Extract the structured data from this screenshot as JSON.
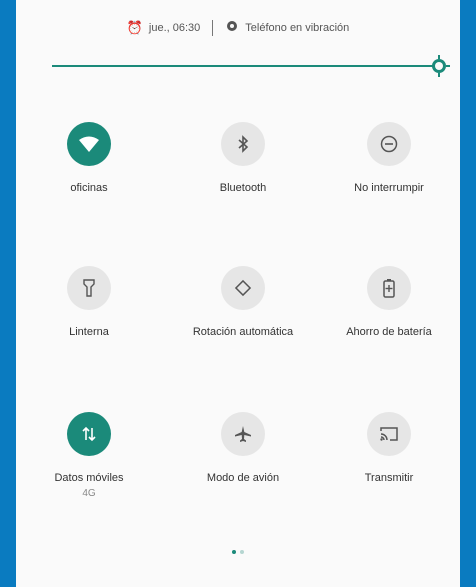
{
  "status": {
    "alarm_text": "jue., 06:30",
    "ringer_text": "Teléfono en vibración"
  },
  "brightness": {
    "level": 1.0
  },
  "tiles": [
    {
      "label": "oficinas",
      "icon": "wifi-icon",
      "active": true
    },
    {
      "label": "Bluetooth",
      "icon": "bluetooth-icon",
      "active": false
    },
    {
      "label": "No interrumpir",
      "icon": "do-not-disturb-icon",
      "active": false
    },
    {
      "label": "Linterna",
      "icon": "flashlight-icon",
      "active": false
    },
    {
      "label": "Rotación automática",
      "icon": "auto-rotate-icon",
      "active": false
    },
    {
      "label": "Ahorro de batería",
      "icon": "battery-saver-icon",
      "active": false
    },
    {
      "label": "Datos móviles",
      "sublabel": "4G",
      "icon": "mobile-data-icon",
      "active": true
    },
    {
      "label": "Modo de avión",
      "icon": "airplane-icon",
      "active": false
    },
    {
      "label": "Transmitir",
      "icon": "cast-icon",
      "active": false
    }
  ],
  "pager": {
    "pages": 2,
    "current": 1
  },
  "colors": {
    "accent": "#1b8a7a",
    "frame": "#0a7bc0",
    "inactive": "#e6e6e6"
  }
}
